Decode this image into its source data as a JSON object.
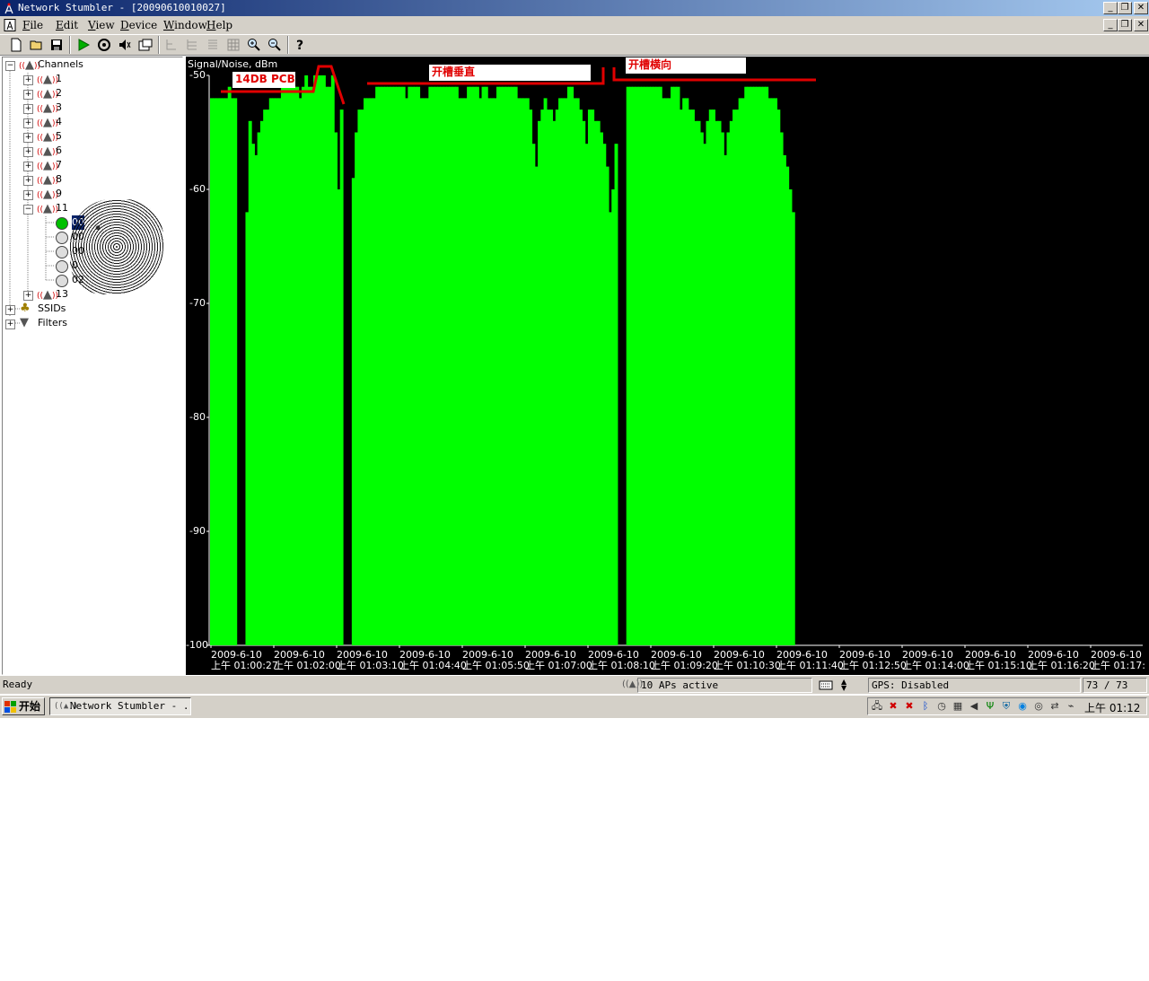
{
  "window": {
    "title": "Network Stumbler - [20090610010027]",
    "controls": [
      "_",
      "❐",
      "✕"
    ],
    "mdi_controls": [
      "_",
      "❐",
      "✕"
    ]
  },
  "menu": {
    "items": [
      {
        "label": "File",
        "key": "F",
        "rest": "ile"
      },
      {
        "label": "Edit",
        "key": "E",
        "rest": "dit"
      },
      {
        "label": "View",
        "key": "V",
        "rest": "iew"
      },
      {
        "label": "Device",
        "key": "D",
        "rest": "evice"
      },
      {
        "label": "Window",
        "key": "W",
        "rest": "indow"
      },
      {
        "label": "Help",
        "key": "H",
        "rest": "elp"
      }
    ]
  },
  "toolbar": {
    "icons": [
      "new-icon",
      "open-icon",
      "save-icon",
      "play-icon",
      "auto-config-icon",
      "sound-icon",
      "properties-icon",
      "tree-icon",
      "tree-expand-icon",
      "tree-collapse-icon",
      "grid-icon",
      "zoom-in-icon",
      "zoom-out-icon",
      "help-icon"
    ]
  },
  "tree": {
    "root": "Channels",
    "channels": [
      "1",
      "2",
      "3",
      "4",
      "5",
      "6",
      "7",
      "8",
      "9",
      "11"
    ],
    "aps_visible": [
      "00",
      "00",
      "00",
      "0",
      "02"
    ],
    "last_channel": "13",
    "ssids": "SSIDs",
    "filters": "Filters"
  },
  "graph": {
    "title": "Signal/Noise, dBm",
    "annotations": [
      {
        "text": "14DB PCB"
      },
      {
        "text": "开槽垂直"
      },
      {
        "text": "开槽横向"
      }
    ]
  },
  "chart_data": {
    "type": "area",
    "title": "Signal/Noise, dBm",
    "ylabel": "Signal/Noise, dBm",
    "y_ticks": [
      "-50",
      "-60",
      "-70",
      "-80",
      "-90",
      "-100"
    ],
    "ylim": [
      -100,
      -50
    ],
    "x_ticks": [
      [
        "2009-6-10",
        "上午 01:00:27"
      ],
      [
        "2009-6-10",
        "上午 01:02:00"
      ],
      [
        "2009-6-10",
        "上午 01:03:10"
      ],
      [
        "2009-6-10",
        "上午 01:04:40"
      ],
      [
        "2009-6-10",
        "上午 01:05:50"
      ],
      [
        "2009-6-10",
        "上午 01:07:00"
      ],
      [
        "2009-6-10",
        "上午 01:08:10"
      ],
      [
        "2009-6-10",
        "上午 01:09:20"
      ],
      [
        "2009-6-10",
        "上午 01:10:30"
      ],
      [
        "2009-6-10",
        "上午 01:11:40"
      ],
      [
        "2009-6-10",
        "上午 01:12:50"
      ],
      [
        "2009-6-10",
        "上午 01:14:00"
      ],
      [
        "2009-6-10",
        "上午 01:15:10"
      ],
      [
        "2009-6-10",
        "上午 01:16:20"
      ],
      [
        "2009-6-10",
        "上午 01:17:"
      ]
    ],
    "color": "#00ff00",
    "series": [
      {
        "values": [
          -52,
          -52,
          -52,
          -52,
          -52,
          -52,
          -51,
          -52,
          -52,
          -100,
          -100,
          -100,
          -62,
          -54,
          -56,
          -57,
          -55,
          -54,
          -53,
          -53,
          -52,
          -52,
          -52,
          -52,
          -51,
          -51,
          -51,
          -51,
          -51,
          -51,
          -52,
          -51,
          -50,
          -51,
          -51,
          -50,
          -50,
          -50,
          -50,
          -51,
          -51,
          -50,
          -55,
          -60,
          -53,
          -100,
          -100,
          -100,
          -59,
          -55,
          -53,
          -53,
          -52,
          -52,
          -52,
          -52,
          -51,
          -51,
          -51,
          -51,
          -51,
          -51,
          -51,
          -51,
          -51,
          -51,
          -52,
          -51,
          -51,
          -51,
          -51,
          -52,
          -52,
          -52,
          -51,
          -51,
          -51,
          -51,
          -51,
          -51,
          -51,
          -51,
          -51,
          -51,
          -52,
          -52,
          -52,
          -51,
          -51,
          -51,
          -51,
          -52,
          -51,
          -51,
          -52,
          -52,
          -52,
          -51,
          -51,
          -51,
          -51,
          -51,
          -51,
          -51,
          -52,
          -52,
          -52,
          -52,
          -53,
          -56,
          -58,
          -54,
          -53,
          -52,
          -53,
          -53,
          -54,
          -53,
          -52,
          -52,
          -52,
          -51,
          -51,
          -52,
          -52,
          -53,
          -54,
          -56,
          -53,
          -53,
          -54,
          -54,
          -55,
          -56,
          -58,
          -62,
          -60,
          -56,
          -100,
          -100,
          -100,
          -51,
          -51,
          -51,
          -51,
          -51,
          -51,
          -51,
          -51,
          -51,
          -51,
          -51,
          -51,
          -52,
          -52,
          -52,
          -51,
          -51,
          -51,
          -53,
          -52,
          -52,
          -53,
          -53,
          -54,
          -54,
          -55,
          -56,
          -54,
          -53,
          -53,
          -54,
          -54,
          -55,
          -57,
          -55,
          -54,
          -53,
          -53,
          -52,
          -52,
          -51,
          -51,
          -51,
          -51,
          -51,
          -51,
          -51,
          -51,
          -52,
          -52,
          -52,
          -53,
          -55,
          -57,
          -58,
          -60,
          -62,
          -100,
          -100,
          -100
        ]
      }
    ],
    "annotations": [
      "14DB PCB",
      "开槽垂直",
      "开槽横向"
    ]
  },
  "status": {
    "ready": "Ready",
    "aps": "10 APs active",
    "gps": "GPS: Disabled",
    "count": "73 / 73"
  },
  "taskbar": {
    "start": "开始",
    "task": "Network Stumbler - ...",
    "clock": "上午 01:12",
    "tray_icons": [
      "network-icon",
      "network-disconnected-icon",
      "network-disconnected-icon",
      "bluetooth-icon",
      "clock-icon",
      "keyboard-icon",
      "volume-icon",
      "antenna-icon",
      "shield-icon",
      "globe-icon",
      "disc-icon",
      "connection-icon",
      "network-tray-icon"
    ]
  }
}
